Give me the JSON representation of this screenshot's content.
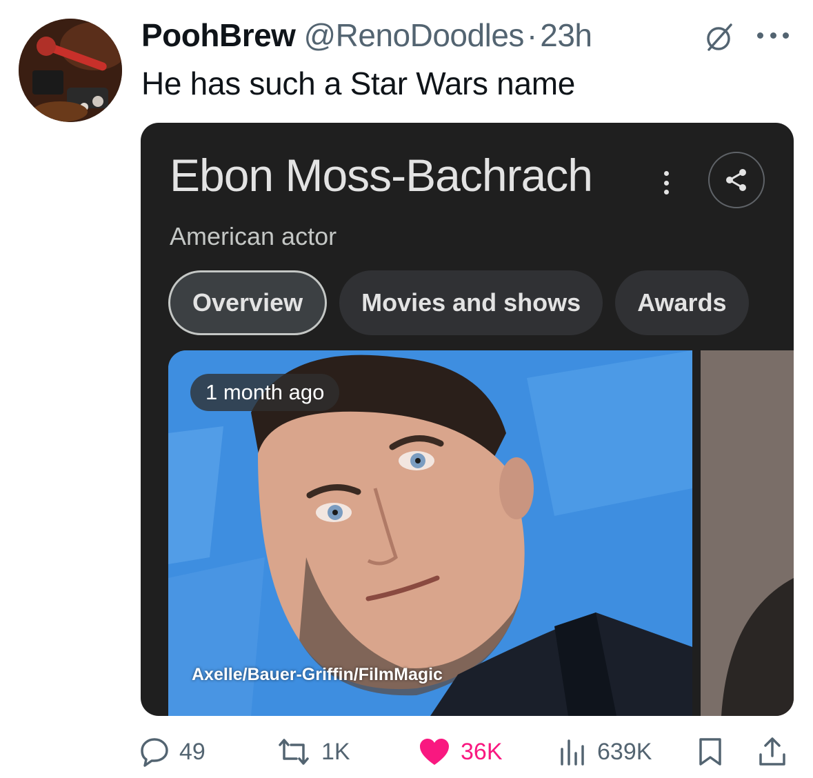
{
  "tweet": {
    "author_name": "PoohBrew",
    "author_handle": "@RenoDoodles",
    "separator": "·",
    "time": "23h",
    "text": "He has such a Star Wars name"
  },
  "card": {
    "title": "Ebon Moss-Bachrach",
    "subtitle": "American actor",
    "tabs": [
      {
        "label": "Overview",
        "active": true
      },
      {
        "label": "Movies and shows",
        "active": false
      },
      {
        "label": "Awards",
        "active": false
      }
    ],
    "photo": {
      "time_badge": "1 month ago",
      "credit": "Axelle/Bauer-Griffin/FilmMagic"
    }
  },
  "actions": {
    "replies": "49",
    "reposts": "1K",
    "likes": "36K",
    "views": "639K"
  },
  "colors": {
    "text_primary": "#0f1419",
    "text_secondary": "#536471",
    "like_pink": "#f91880",
    "card_bg": "#1f1f1f"
  },
  "icons": [
    "grok-icon",
    "more-icon",
    "kebab-icon",
    "share-icon",
    "reply-icon",
    "repost-icon",
    "heart-icon",
    "views-icon",
    "bookmark-icon",
    "upload-icon"
  ]
}
